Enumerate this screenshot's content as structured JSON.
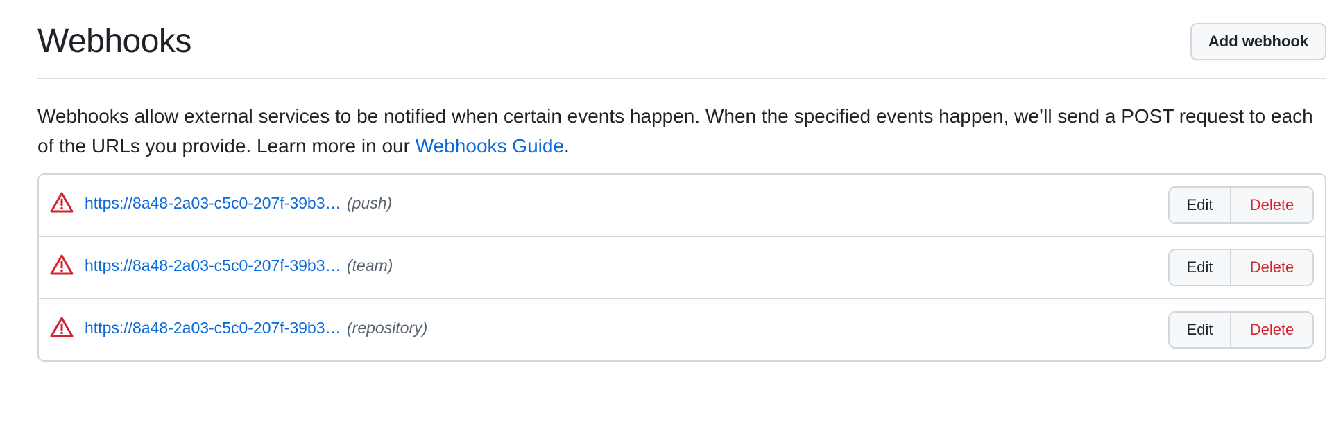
{
  "header": {
    "title": "Webhooks",
    "add_button_label": "Add webhook"
  },
  "description": {
    "text_before_link": "Webhooks allow external services to be notified when certain events happen. When the specified events happen, we’ll send a POST request to each of the URLs you provide. Learn more in our ",
    "link_text": "Webhooks Guide",
    "text_after_link": "."
  },
  "hooks": [
    {
      "url": "https://8a48-2a03-c5c0-207f-39b3…",
      "event": "(push)",
      "status_icon": "alert-icon",
      "edit_label": "Edit",
      "delete_label": "Delete"
    },
    {
      "url": "https://8a48-2a03-c5c0-207f-39b3…",
      "event": "(team)",
      "status_icon": "alert-icon",
      "edit_label": "Edit",
      "delete_label": "Delete"
    },
    {
      "url": "https://8a48-2a03-c5c0-207f-39b3…",
      "event": "(repository)",
      "status_icon": "alert-icon",
      "edit_label": "Edit",
      "delete_label": "Delete"
    }
  ],
  "colors": {
    "link": "#0969da",
    "danger": "#d1242f",
    "border": "#d0d7de",
    "muted_text": "#59636e"
  }
}
